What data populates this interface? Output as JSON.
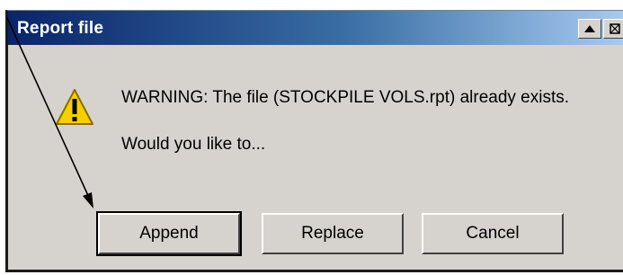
{
  "window": {
    "title": "Report file",
    "controls": [
      "up-arrow-icon",
      "restore-icon"
    ]
  },
  "message": {
    "warning": "WARNING: The file (STOCKPILE VOLS.rpt) already exists.",
    "question": "Would you like to..."
  },
  "buttons": {
    "append": "Append",
    "replace": "Replace",
    "cancel": "Cancel"
  },
  "icons": {
    "warning": "warning-icon"
  },
  "colors": {
    "titlebar_start": "#0a246a",
    "titlebar_end": "#a6caf0",
    "dialog_bg": "#d6d3ce",
    "warning_yellow": "#f5d000"
  }
}
